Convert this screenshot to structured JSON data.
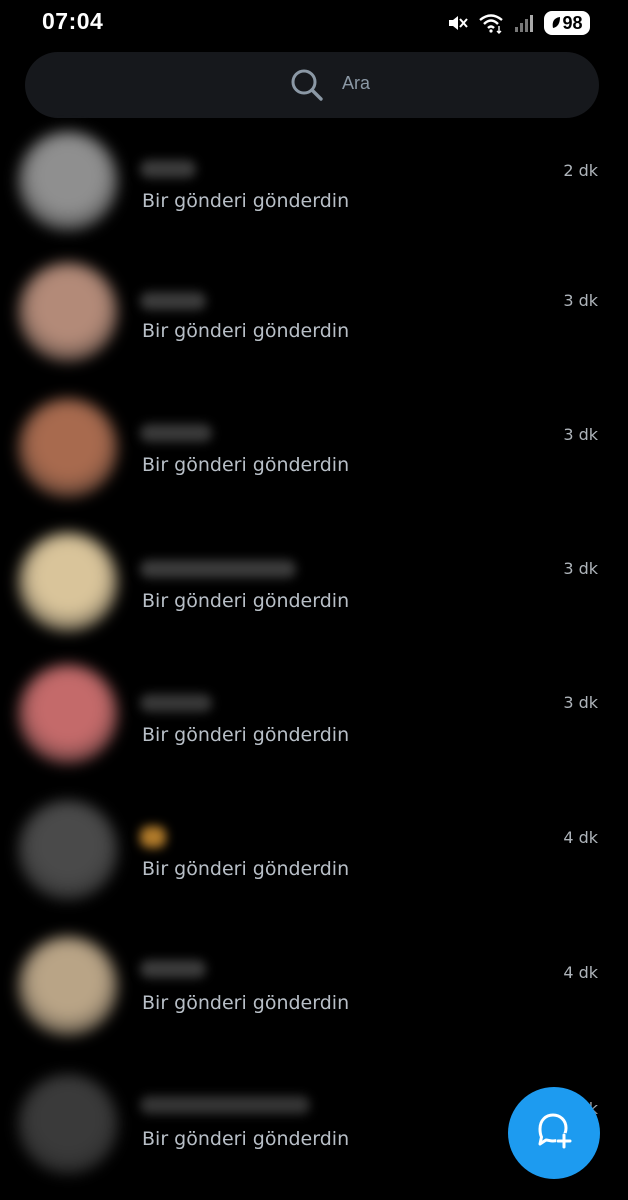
{
  "status_bar": {
    "time": "07:04",
    "battery": "98",
    "icons": [
      "mute-icon",
      "wifi-icon",
      "signal-icon",
      "battery-icon"
    ]
  },
  "search": {
    "placeholder": "Ara"
  },
  "conversations": [
    {
      "snippet": "Bir gönderi gönderdin",
      "time": "2 dk",
      "avatar_color": "#8f8f8f",
      "name_color": "#3c3c3c"
    },
    {
      "snippet": "Bir gönderi gönderdin",
      "time": "3 dk",
      "avatar_color": "#b38a78",
      "name_color": "#3c3c3c"
    },
    {
      "snippet": "Bir gönderi gönderdin",
      "time": "3 dk",
      "avatar_color": "#a86a4e",
      "name_color": "#3a3a3a"
    },
    {
      "snippet": "Bir gönderi gönderdin",
      "time": "3 dk",
      "avatar_color": "#d9c49a",
      "name_color": "#3c3c3c"
    },
    {
      "snippet": "Bir gönderi gönderdin",
      "time": "3 dk",
      "avatar_color": "#c46a6a",
      "name_color": "#383838"
    },
    {
      "snippet": "Bir gönderi gönderdin",
      "time": "4 dk",
      "avatar_color": "#4a4a4a",
      "name_color": "#b07a2a"
    },
    {
      "snippet": "Bir gönderi gönderdin",
      "time": "4 dk",
      "avatar_color": "#b9a486",
      "name_color": "#3c3c3c"
    },
    {
      "snippet": "Bir gönderi gönderdin",
      "time": "dk",
      "avatar_color": "#3a3a3a",
      "name_color": "#353535"
    }
  ],
  "fab": {
    "icon": "new-message-icon",
    "color": "#1d9bf0"
  }
}
